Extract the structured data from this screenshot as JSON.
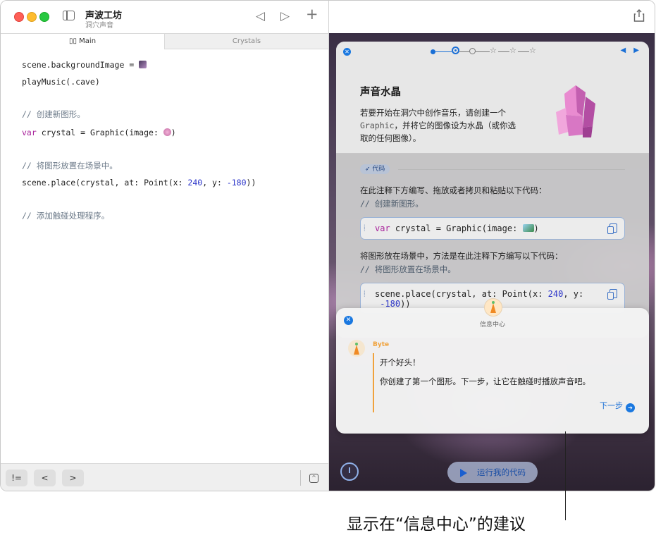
{
  "left": {
    "app_title": "声波工坊",
    "app_subtitle": "洞穴声音",
    "toolbar": {
      "back_icon": "◁",
      "run_icon": "▷",
      "add_icon": "+"
    },
    "tabs": [
      {
        "label": "Main",
        "icon": "book-icon"
      },
      {
        "label": "Crystals"
      }
    ],
    "code": {
      "line1_a": "scene.backgroundImage = ",
      "line2": "playMusic(.cave)",
      "cmt1": "// 创建新图形。",
      "kw": "var",
      "line3_a": " crystal = Graphic(image: ",
      "line3_b": ")",
      "cmt2": "// 将图形放置在场景中。",
      "line4_a": "scene.place(crystal, at: Point(x: ",
      "line4_n1": "240",
      "line4_b": ", y: ",
      "line4_n2": "-180",
      "line4_c": "))",
      "cmt3": "// 添加触碰处理程序。"
    },
    "bottom": {
      "neq_label": "!=",
      "prev_label": "<",
      "next_label": ">"
    }
  },
  "guide": {
    "close_icon": "✕",
    "nav_icons": "◀ ▶",
    "title": "声音水晶",
    "intro_1": "若要开始在洞穴中创作音乐，请创建一个",
    "intro_code": "Graphic",
    "intro_2": "，并将它的图像设为水晶（或你选取的任何图像）。",
    "pill_label": "代码",
    "step1_text": "在此注释下方编写、拖放或者拷贝和粘贴以下代码：",
    "step1_cmt": "// 创建新图形。",
    "snippet1_kw": "var",
    "snippet1_a": " crystal = Graphic(image: ",
    "snippet1_b": ")",
    "step2_text": "将图形放在场景中，方法是在此注释下方编写以下代码：",
    "step2_cmt": "// 将图形放置在场景中。",
    "snippet2_a": "scene.place(crystal, at: Point(x: ",
    "snippet2_n1": "240",
    "snippet2_b": ", y:",
    "snippet2_n2": "-180",
    "snippet2_c": "))"
  },
  "message": {
    "close_icon": "✕",
    "header": "信息中心",
    "sender": "Byte",
    "line1": "开个好头！",
    "line2": "你创建了第一个图形。下一步，让它在触碰时播放声音吧。",
    "next_label": "下一步",
    "next_icon": "➔"
  },
  "run_button": "运行我的代码",
  "annotation": "显示在“信息中心”的建议",
  "colors": {
    "accent": "#1a78e0",
    "byte_orange": "#f0a23c",
    "keyword": "#a8239b",
    "number": "#2a33c9"
  }
}
